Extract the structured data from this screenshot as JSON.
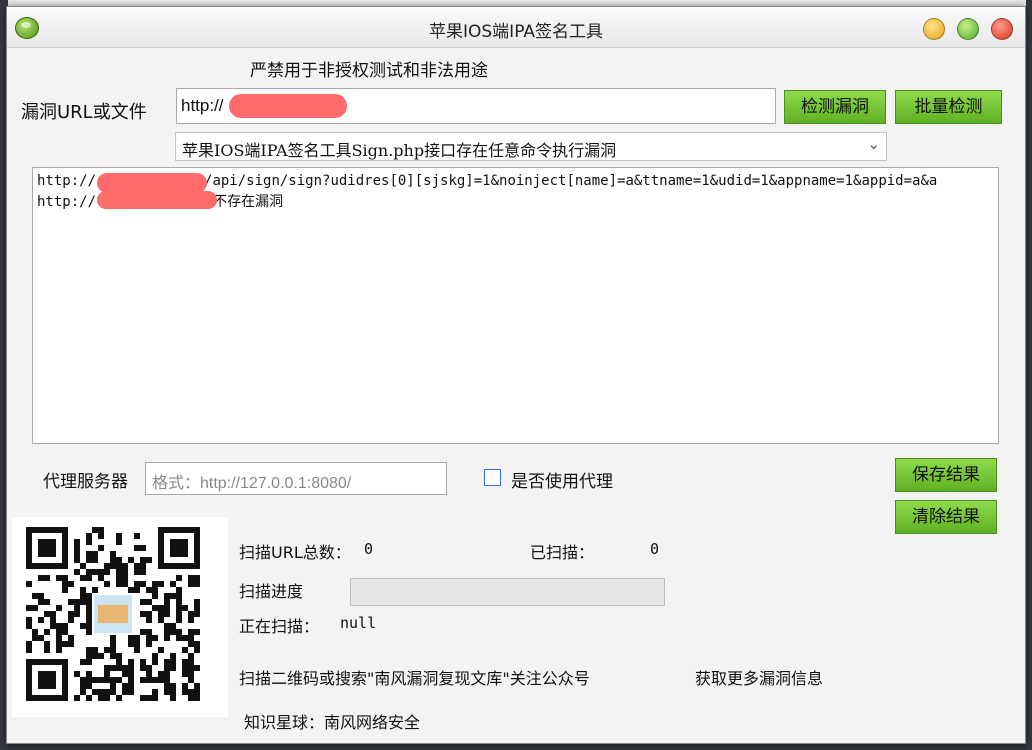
{
  "window": {
    "title": "苹果IOS端IPA签名工具"
  },
  "notice": "严禁用于非授权测试和非法用途",
  "url_field": {
    "label": "漏洞URL或文件",
    "value": "http://"
  },
  "buttons": {
    "detect": "检测漏洞",
    "batch": "批量检测",
    "save": "保存结果",
    "clear": "清除结果"
  },
  "vuln_select": {
    "selected": "苹果IOS端IPA签名工具Sign.php接口存在任意命令执行漏洞"
  },
  "output": {
    "lines": [
      {
        "prefix": "http://",
        "suffix": "/api/sign/sign?udidres[0][sjskg]=1&noinject[name]=a&ttname=1&udid=1&appname=1&appid=a&a"
      },
      {
        "prefix": "http://",
        "suffix": "/  不存在漏洞"
      }
    ]
  },
  "proxy": {
    "label": "代理服务器",
    "placeholder": "格式：http://127.0.0.1:8080/",
    "checkbox_label": "是否使用代理",
    "checked": false
  },
  "stats": {
    "total_label": "扫描URL总数：",
    "total_value": "0",
    "scanned_label": "已扫描：",
    "scanned_value": "0",
    "progress_label": "扫描进度",
    "progress_value": 0,
    "current_label": "正在扫描：",
    "current_value": "null"
  },
  "footer": {
    "qr_text": "扫描二维码或搜索\"南风漏洞复现文库\"关注公众号",
    "more_info": "获取更多漏洞信息",
    "planet": "知识星球：南风网络安全"
  },
  "colors": {
    "button_green": "#6cc02e",
    "redaction": "#ff6b6b"
  }
}
